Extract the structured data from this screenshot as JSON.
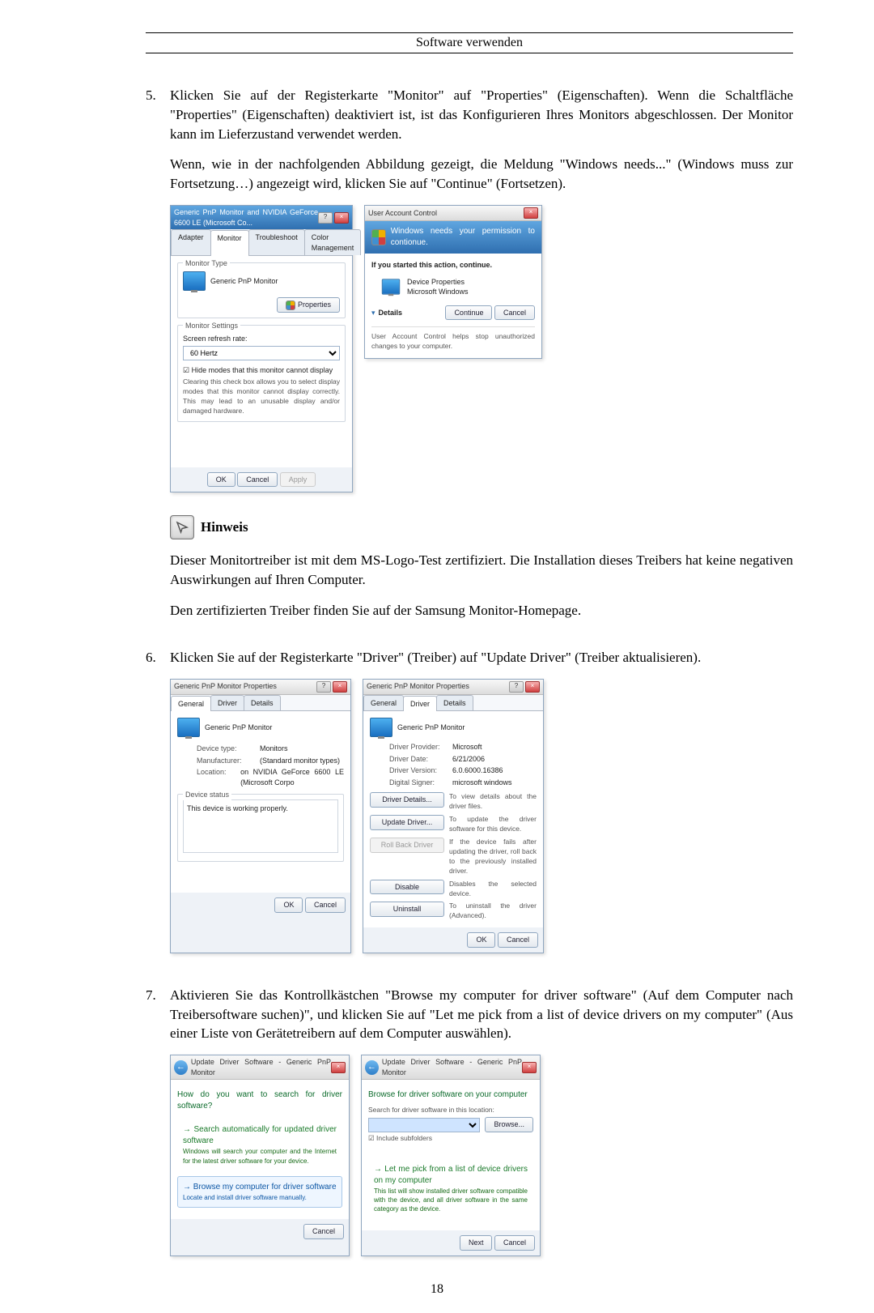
{
  "page": {
    "header": "Software verwenden",
    "number": "18"
  },
  "steps": {
    "s5": {
      "num": "5.",
      "p1": "Klicken Sie auf der Registerkarte \"Monitor\" auf \"Properties\" (Eigenschaften). Wenn die Schaltfläche \"Properties\" (Eigenschaften) deaktiviert ist, ist das Konfigurieren Ihres Monitors abgeschlossen. Der Monitor kann im Lieferzustand verwendet werden.",
      "p2": "Wenn, wie in der nachfolgenden Abbildung gezeigt, die Meldung \"Windows needs...\" (Windows muss zur Fortsetzung…) angezeigt wird, klicken Sie auf \"Continue\" (Fortsetzen)."
    },
    "s6": {
      "num": "6.",
      "p1": "Klicken Sie auf der Registerkarte \"Driver\" (Treiber) auf \"Update Driver\" (Treiber aktualisieren)."
    },
    "s7": {
      "num": "7.",
      "p1": "Aktivieren Sie das Kontrollkästchen \"Browse my computer for driver software\" (Auf dem Computer nach Treibersoftware suchen)\", und klicken Sie auf \"Let me pick from a list of device drivers on my computer\" (Aus einer Liste von Gerätetreibern auf dem Computer auswählen)."
    }
  },
  "note": {
    "label": "Hinweis",
    "p1": "Dieser Monitortreiber ist mit dem MS-Logo-Test zertifiziert. Die Installation dieses Treibers hat keine negativen Auswirkungen auf Ihren Computer.",
    "p2": "Den zertifizierten Treiber finden Sie auf der Samsung Monitor-Homepage."
  },
  "dlg_monitor": {
    "title": "Generic PnP Monitor and NVIDIA GeForce 6600 LE (Microsoft Co...",
    "tabs": {
      "adapter": "Adapter",
      "monitor": "Monitor",
      "troubleshoot": "Troubleshoot",
      "color": "Color Management"
    },
    "mtype_label": "Monitor Type",
    "mtype_val": "Generic PnP Monitor",
    "properties_btn": "Properties",
    "msettings_label": "Monitor Settings",
    "refresh_label": "Screen refresh rate:",
    "refresh_val": "60 Hertz",
    "hide_chk": "Hide modes that this monitor cannot display",
    "hide_desc": "Clearing this check box allows you to select display modes that this monitor cannot display correctly. This may lead to an unusable display and/or damaged hardware.",
    "ok": "OK",
    "cancel": "Cancel",
    "apply": "Apply"
  },
  "dlg_uac": {
    "title": "User Account Control",
    "headline": "Windows needs your permission to contionue.",
    "started": "If you started this action, continue.",
    "app": "Device Properties",
    "publisher": "Microsoft Windows",
    "details": "Details",
    "continue": "Continue",
    "cancel": "Cancel",
    "footer": "User Account Control helps stop unauthorized changes to your computer."
  },
  "dlg_prop_general": {
    "title": "Generic PnP Monitor Properties",
    "tabs": {
      "general": "General",
      "driver": "Driver",
      "details": "Details"
    },
    "name": "Generic PnP Monitor",
    "dev_type_k": "Device type:",
    "dev_type_v": "Monitors",
    "manu_k": "Manufacturer:",
    "manu_v": "(Standard monitor types)",
    "loc_k": "Location:",
    "loc_v": "on NVIDIA GeForce 6600 LE (Microsoft Corpo",
    "status_label": "Device status",
    "status_text": "This device is working properly.",
    "ok": "OK",
    "cancel": "Cancel"
  },
  "dlg_prop_driver": {
    "title": "Generic PnP Monitor Properties",
    "tabs": {
      "general": "General",
      "driver": "Driver",
      "details": "Details"
    },
    "name": "Generic PnP Monitor",
    "prov_k": "Driver Provider:",
    "prov_v": "Microsoft",
    "date_k": "Driver Date:",
    "date_v": "6/21/2006",
    "ver_k": "Driver Version:",
    "ver_v": "6.0.6000.16386",
    "sign_k": "Digital Signer:",
    "sign_v": "microsoft windows",
    "btn_details": "Driver Details...",
    "btn_details_d": "To view details about the driver files.",
    "btn_update": "Update Driver...",
    "btn_update_d": "To update the driver software for this device.",
    "btn_roll": "Roll Back Driver",
    "btn_roll_d": "If the device fails after updating the driver, roll back to the previously installed driver.",
    "btn_disable": "Disable",
    "btn_disable_d": "Disables the selected device.",
    "btn_uninst": "Uninstall",
    "btn_uninst_d": "To uninstall the driver (Advanced).",
    "ok": "OK",
    "cancel": "Cancel"
  },
  "dlg_wiz1": {
    "title": "Update Driver Software - Generic PnP Monitor",
    "heading": "How do you want to search for driver software?",
    "opt1_title": "Search automatically for updated driver software",
    "opt1_desc": "Windows will search your computer and the Internet for the latest driver software for your device.",
    "opt2_title": "Browse my computer for driver software",
    "opt2_desc": "Locate and install driver software manually.",
    "cancel": "Cancel"
  },
  "dlg_wiz2": {
    "title": "Update Driver Software - Generic PnP Monitor",
    "heading": "Browse for driver software on your computer",
    "search_label": "Search for driver software in this location:",
    "path": "",
    "browse": "Browse...",
    "include_chk": "Include subfolders",
    "opt_title": "Let me pick from a list of device drivers on my computer",
    "opt_desc": "This list will show installed driver software compatible with the device, and all driver software in the same category as the device.",
    "next": "Next",
    "cancel": "Cancel"
  }
}
